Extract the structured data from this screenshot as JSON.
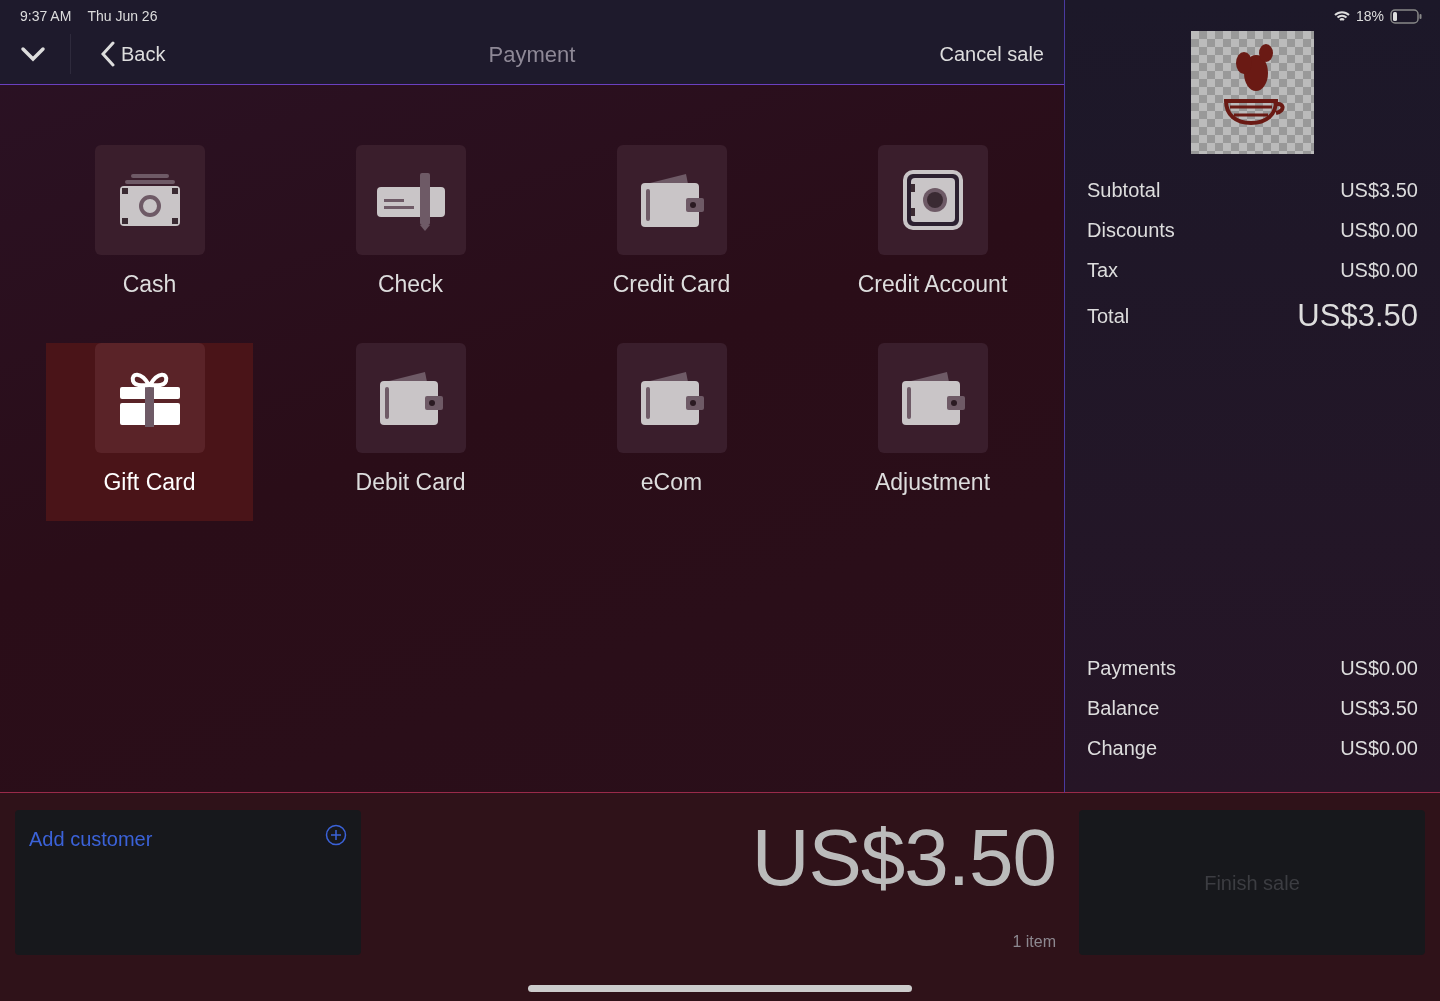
{
  "status_bar": {
    "time": "9:37 AM",
    "date": "Thu Jun 26",
    "battery": "18%"
  },
  "nav": {
    "back": "Back",
    "title": "Payment",
    "cancel": "Cancel sale"
  },
  "payment_methods": [
    {
      "label": "Cash",
      "kind": "cash",
      "selected": false
    },
    {
      "label": "Check",
      "kind": "check",
      "selected": false
    },
    {
      "label": "Credit Card",
      "kind": "wallet",
      "selected": false
    },
    {
      "label": "Credit Account",
      "kind": "safe",
      "selected": false
    },
    {
      "label": "Gift Card",
      "kind": "gift",
      "selected": true
    },
    {
      "label": "Debit Card",
      "kind": "wallet",
      "selected": false
    },
    {
      "label": "eCom",
      "kind": "wallet",
      "selected": false
    },
    {
      "label": "Adjustment",
      "kind": "wallet",
      "selected": false
    }
  ],
  "summary": [
    {
      "label": "Subtotal",
      "value": "US$3.50",
      "kind": "line"
    },
    {
      "label": "Discounts",
      "value": "US$0.00",
      "kind": "line"
    },
    {
      "label": "Tax",
      "value": "US$0.00",
      "kind": "line"
    },
    {
      "label": "Total",
      "value": "US$3.50",
      "kind": "total"
    }
  ],
  "payments_summary": [
    {
      "label": "Payments",
      "value": "US$0.00"
    },
    {
      "label": "Balance",
      "value": "US$3.50"
    },
    {
      "label": "Change",
      "value": "US$0.00"
    }
  ],
  "customer": {
    "label": "Add customer"
  },
  "amount": "US$3.50",
  "item_count": "1 item",
  "finish": {
    "label": "Finish sale",
    "disabled": true
  }
}
